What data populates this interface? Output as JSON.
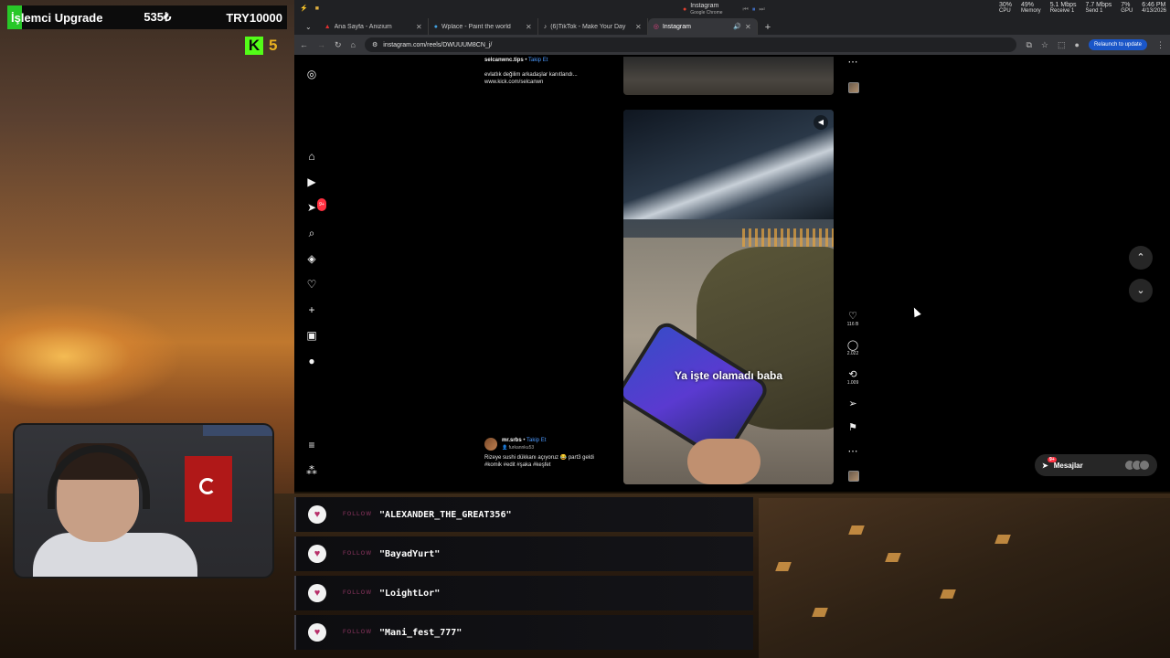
{
  "overlay": {
    "upgrade_name": "İşlemci Upgrade",
    "upgrade_cost": "535₺",
    "upgrade_goal": "TRY10000",
    "kick_icon": "K",
    "kick_count": "5"
  },
  "os": {
    "app_title": "Instagram",
    "app_subtitle": "Google Chrome",
    "stats": [
      {
        "value": "30%",
        "label": "CPU"
      },
      {
        "value": "49%",
        "label": "Memory"
      },
      {
        "value": "5.1 Mbps",
        "label": "Receive 1"
      },
      {
        "value": "7.7 Mbps",
        "label": "Send 1"
      },
      {
        "value": "7%",
        "label": "GPU"
      }
    ],
    "time": "6:46 PM",
    "date": "4/13/2026"
  },
  "browser": {
    "tabs": [
      {
        "label": "Ana Sayfa - Anizium"
      },
      {
        "label": "Wplace - Paint the world"
      },
      {
        "label": "(6)TikTok - Make Your Day"
      },
      {
        "label": "Instagram"
      }
    ],
    "url": "instagram.com/reels/DWUUUM8CN_j/",
    "relaunch": "Relaunch to update"
  },
  "reel_prev": {
    "user": "selcanwnc.tips",
    "follow": "Takip Et",
    "caption": "evlatlık değilim arkadaşlar kanıtlandı... www.kick.com/selcanwn"
  },
  "reel": {
    "overlay_caption": "Ya işte olamadı baba",
    "user": "mr.srbs",
    "follow": "Takip Et",
    "collab": "furkannku53",
    "caption": "Rizeye sushi dükkanı açıyoruz 😂 part3 geldi #komik #edit #şaka #keşfet",
    "likes": "116 B",
    "comments": "2.022",
    "reposts": "1.009"
  },
  "messages": {
    "label": "Mesajlar",
    "badge": "9+"
  },
  "notifications_badge": "9+",
  "alerts": [
    {
      "tag": "FOLLOW",
      "name": "\"ALEXANDER_THE_GREAT356\""
    },
    {
      "tag": "FOLLOW",
      "name": "\"BayadYurt\""
    },
    {
      "tag": "FOLLOW",
      "name": "\"LoightLor\""
    },
    {
      "tag": "FOLLOW",
      "name": "\"Mani_fest_777\""
    }
  ]
}
